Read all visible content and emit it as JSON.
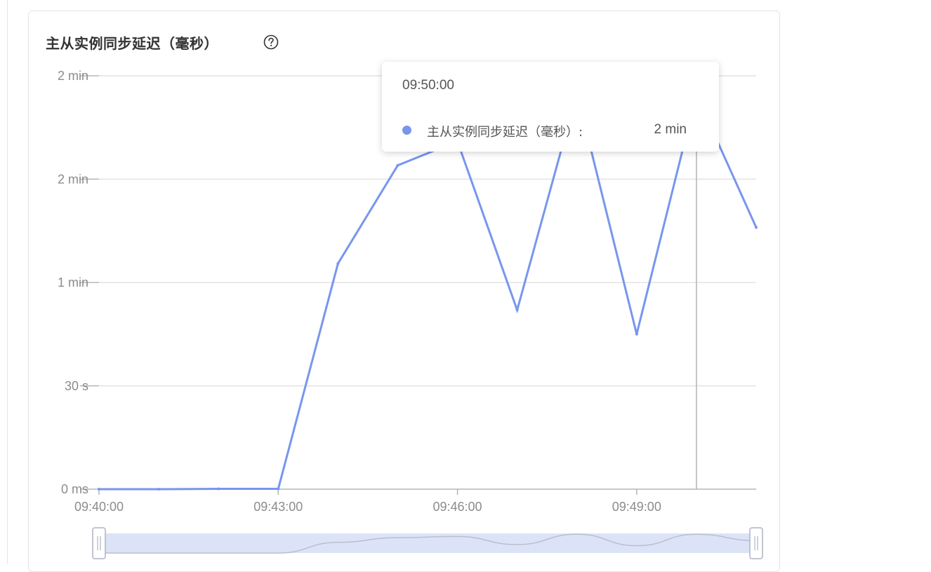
{
  "card": {
    "title": "主从实例同步延迟（毫秒）",
    "help_icon": "question-circle-icon"
  },
  "tooltip": {
    "time": "09:50:00",
    "series_name": "主从实例同步延迟（毫秒）:",
    "value": "2 min"
  },
  "colors": {
    "series": "#7896ee",
    "grid": "#e3e3e3",
    "slider_fill": "#dde3f7"
  },
  "chart_data": {
    "type": "line",
    "title": "主从实例同步延迟（毫秒）",
    "x_unit": "minutes after 09:40:00",
    "y_unit": "seconds",
    "x_ticks": [
      {
        "x": 0,
        "label": "09:40:00"
      },
      {
        "x": 3,
        "label": "09:43:00"
      },
      {
        "x": 6,
        "label": "09:46:00"
      },
      {
        "x": 9,
        "label": "09:49:00"
      }
    ],
    "y_ticks": [
      {
        "y": 0,
        "label": "0 ms"
      },
      {
        "y": 30,
        "label": "30 s"
      },
      {
        "y": 60,
        "label": "1 min"
      },
      {
        "y": 90,
        "label": "2 min"
      },
      {
        "y": 120,
        "label": "2 min"
      }
    ],
    "xlim": [
      0,
      11
    ],
    "ylim": [
      0,
      120
    ],
    "grid": true,
    "series": [
      {
        "points": [
          [
            0,
            0
          ],
          [
            1,
            0
          ],
          [
            2,
            0.1
          ],
          [
            3,
            0.1
          ],
          [
            4,
            65.5
          ],
          [
            5,
            94
          ],
          [
            6,
            101
          ],
          [
            7,
            52
          ],
          [
            8,
            115
          ],
          [
            9,
            45
          ],
          [
            10,
            114.5
          ],
          [
            11,
            76
          ]
        ]
      }
    ],
    "hover": {
      "x": 10,
      "value_label": "2 min"
    },
    "zoom_range": [
      0,
      11
    ]
  }
}
